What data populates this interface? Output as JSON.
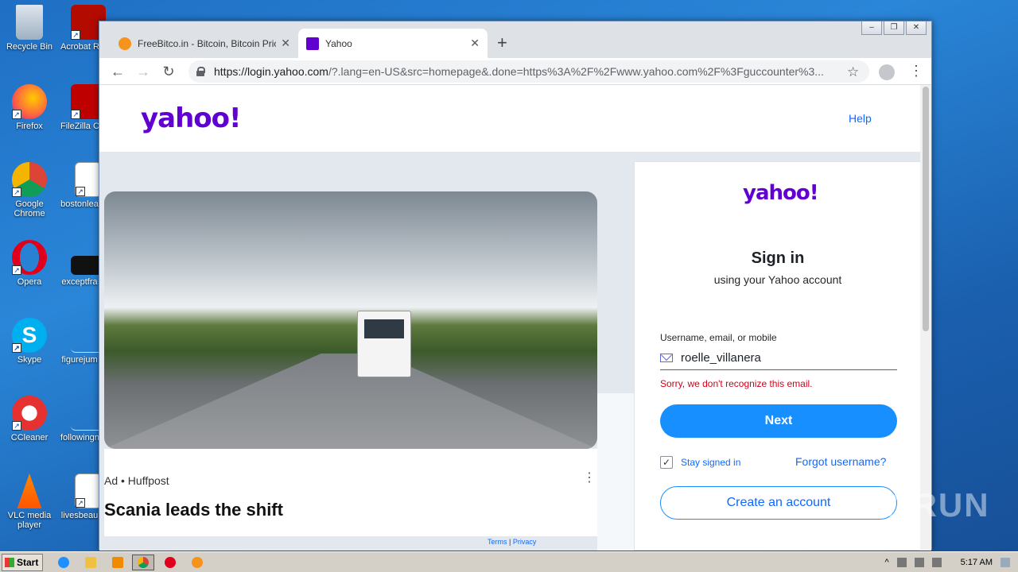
{
  "desktop": {
    "icons": [
      {
        "label": "Recycle Bin"
      },
      {
        "label": "Acrobat Reader"
      },
      {
        "label": "Firefox"
      },
      {
        "label": "FileZilla C"
      },
      {
        "label": "Google Chrome"
      },
      {
        "label": "bostonlea"
      },
      {
        "label": "Opera"
      },
      {
        "label": "exceptfra"
      },
      {
        "label": "Skype"
      },
      {
        "label": "figurejum"
      },
      {
        "label": "CCleaner"
      },
      {
        "label": "followingn"
      },
      {
        "label": "VLC media player"
      },
      {
        "label": "livesbeau"
      }
    ]
  },
  "browser": {
    "tabs": [
      {
        "title": "FreeBitco.in - Bitcoin, Bitcoin Price, F",
        "favicon_color": "#f7931a"
      },
      {
        "title": "Yahoo",
        "favicon_color": "#6001d2"
      }
    ],
    "url_main": "https://login.yahoo.com",
    "url_rest": "/?.lang=en-US&src=homepage&.done=https%3A%2F%2Fwww.yahoo.com%2F%3Fguccounter%3..."
  },
  "page": {
    "logo": "yahoo!",
    "help": "Help",
    "ad": {
      "label": "Ad • Huffpost",
      "title": "Scania leads the shift"
    },
    "signin": {
      "logo": "yahoo!",
      "title": "Sign in",
      "subtitle": "using your Yahoo account",
      "field_label": "Username, email, or mobile",
      "field_value": "roelle_villanera",
      "error": "Sorry, we don't recognize this email.",
      "next": "Next",
      "stay_signed_in": "Stay signed in",
      "forgot": "Forgot username?",
      "create": "Create an account"
    },
    "footer": {
      "terms": "Terms",
      "privacy": "Privacy"
    }
  },
  "watermark": "ANY RUN",
  "taskbar": {
    "start": "Start",
    "clock": "5:17 AM"
  },
  "colors": {
    "yahoo_purple": "#6001d2",
    "yahoo_blue": "#188fff",
    "error_red": "#d0021b"
  }
}
